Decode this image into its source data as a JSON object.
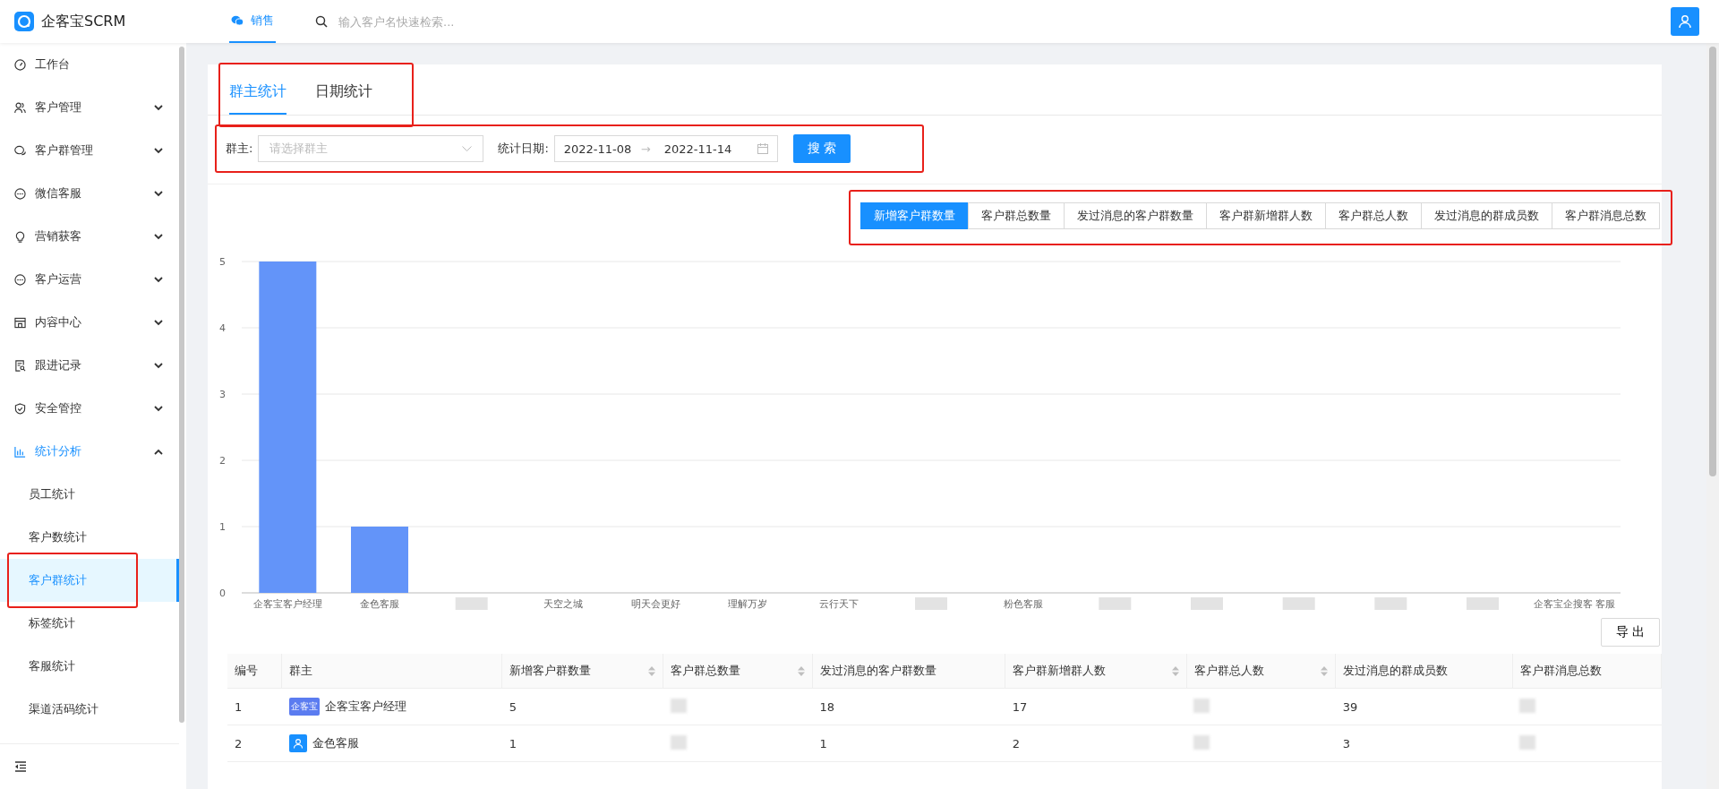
{
  "app": {
    "name": "企客宝SCRM"
  },
  "top_nav": {
    "tabs": [
      {
        "label": "销售",
        "selected": true
      }
    ],
    "search": {
      "placeholder": "输入客户名快速检索..."
    }
  },
  "sidebar": {
    "items": [
      {
        "label": "工作台",
        "selected": false
      },
      {
        "label": "客户管理",
        "expanded": false,
        "selected": false
      },
      {
        "label": "客户群管理",
        "expanded": false,
        "selected": false
      },
      {
        "label": "微信客服",
        "expanded": false,
        "selected": false
      },
      {
        "label": "营销获客",
        "expanded": false,
        "selected": false
      },
      {
        "label": "客户运营",
        "expanded": false,
        "selected": false
      },
      {
        "label": "内容中心",
        "expanded": false,
        "selected": false
      },
      {
        "label": "跟进记录",
        "expanded": false,
        "selected": false
      },
      {
        "label": "安全管控",
        "expanded": false,
        "selected": false
      },
      {
        "label": "统计分析",
        "expanded": true,
        "selected": true,
        "children": [
          {
            "label": "员工统计",
            "selected": false,
            "highlighted": false
          },
          {
            "label": "客户数统计",
            "selected": false,
            "highlighted": false
          },
          {
            "label": "客户群统计",
            "selected": true,
            "highlighted": true
          },
          {
            "label": "标签统计",
            "selected": false,
            "highlighted": false
          },
          {
            "label": "客服统计",
            "selected": false,
            "highlighted": false
          },
          {
            "label": "渠道活码统计",
            "selected": false,
            "highlighted": false
          }
        ]
      }
    ]
  },
  "tabs": {
    "highlighted": true,
    "items": [
      {
        "label": "群主统计",
        "selected": true
      },
      {
        "label": "日期统计",
        "selected": false
      }
    ]
  },
  "filter": {
    "highlighted": true,
    "owner_label": "群主:",
    "owner_placeholder": "请选择群主",
    "date_label": "统计日期:",
    "date_start": "2022-11-08",
    "date_separator": "→",
    "date_end": "2022-11-14",
    "search_button": "搜 索"
  },
  "metrics": {
    "highlighted": true,
    "items": [
      {
        "label": "新增客户群数量",
        "selected": true
      },
      {
        "label": "客户群总数量",
        "selected": false
      },
      {
        "label": "发过消息的客户群数量",
        "selected": false
      },
      {
        "label": "客户群新增群人数",
        "selected": false
      },
      {
        "label": "客户群总人数",
        "selected": false
      },
      {
        "label": "发过消息的群成员数",
        "selected": false
      },
      {
        "label": "客户群消息总数",
        "selected": false
      }
    ]
  },
  "chart_data": {
    "type": "bar",
    "categories": [
      "企客宝客户经理",
      "金色客服",
      null,
      "天空之城",
      "明天会更好",
      "理解万岁",
      "云行天下",
      null,
      "粉色客服",
      null,
      null,
      null,
      null,
      null,
      "企客宝企搜客 客服"
    ],
    "values": [
      5,
      1,
      0,
      0,
      0,
      0,
      0,
      0,
      0,
      0,
      0,
      0,
      0,
      0,
      0
    ],
    "ylim": [
      0,
      5
    ],
    "yticks": [
      0,
      1,
      2,
      3,
      4,
      5
    ],
    "grid": true
  },
  "export_button": "导 出",
  "table": {
    "columns": [
      {
        "label": "编号",
        "sortable": false
      },
      {
        "label": "群主",
        "sortable": false
      },
      {
        "label": "新增客户群数量",
        "sortable": true
      },
      {
        "label": "客户群总数量",
        "sortable": true
      },
      {
        "label": "发过消息的客户群数量",
        "sortable": false
      },
      {
        "label": "客户群新增群人数",
        "sortable": true
      },
      {
        "label": "客户群总人数",
        "sortable": true
      },
      {
        "label": "发过消息的群成员数",
        "sortable": false
      },
      {
        "label": "客户群消息总数",
        "sortable": false
      }
    ],
    "rows": [
      {
        "avatar": {
          "kind": "logo",
          "text": "企客宝"
        },
        "cells": [
          "1",
          "企客宝客户经理",
          "5",
          null,
          "18",
          "17",
          null,
          "39",
          null
        ]
      },
      {
        "avatar": {
          "kind": "person"
        },
        "cells": [
          "2",
          "金色客服",
          "1",
          null,
          "1",
          "2",
          null,
          "3",
          null
        ]
      }
    ]
  }
}
